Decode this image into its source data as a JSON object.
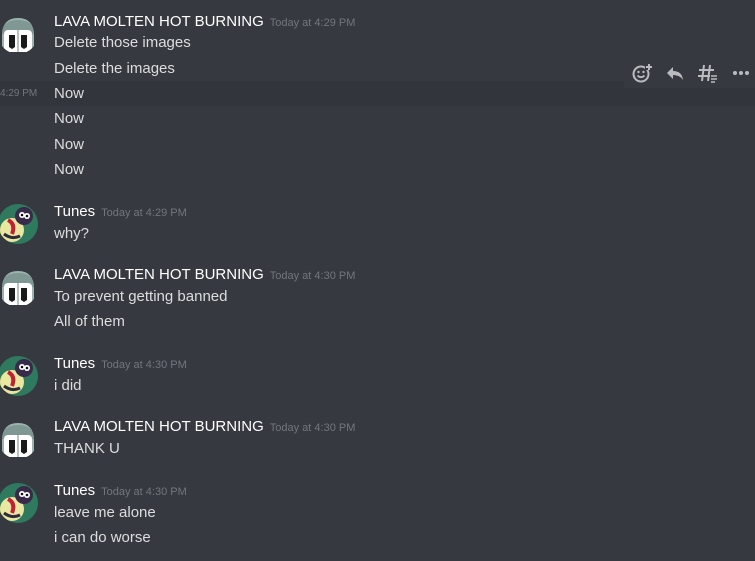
{
  "users": {
    "lava": {
      "name": "LAVA MOLTEN HOT BURNING",
      "avatar_icon": "helmet-avatar-icon"
    },
    "tunes": {
      "name": "Tunes",
      "avatar_icon": "character-avatar-icon"
    }
  },
  "groups": [
    {
      "user": "LAVA MOLTEN HOT BURNING",
      "timestamp": "Today at 4:29 PM",
      "messages": [
        "Delete those images",
        "Delete the images",
        "Now",
        "Now",
        "Now",
        "Now"
      ]
    },
    {
      "user": "Tunes",
      "timestamp": "Today at 4:29 PM",
      "messages": [
        "why?"
      ]
    },
    {
      "user": "LAVA MOLTEN HOT BURNING",
      "timestamp": "Today at 4:30 PM",
      "messages": [
        "To prevent getting banned",
        "All of them"
      ]
    },
    {
      "user": "Tunes",
      "timestamp": "Today at 4:30 PM",
      "messages": [
        "i did"
      ]
    },
    {
      "user": "LAVA MOLTEN HOT BURNING",
      "timestamp": "Today at 4:30 PM",
      "messages": [
        "THANK U"
      ]
    },
    {
      "user": "Tunes",
      "timestamp": "Today at 4:30 PM",
      "messages": [
        "leave me alone",
        "i can do worse"
      ]
    }
  ],
  "hovered_message": {
    "time": "4:29 PM"
  },
  "message_toolbar": {
    "icons": [
      "add-reaction-icon",
      "reply-icon",
      "thread-icon",
      "more-options-icon"
    ]
  },
  "colors": {
    "background": "#36393f",
    "hover_background": "#32353b",
    "username": "#ffffff",
    "message_text": "#dcddde",
    "timestamp": "#72767d",
    "icon": "#b9bbbe"
  }
}
